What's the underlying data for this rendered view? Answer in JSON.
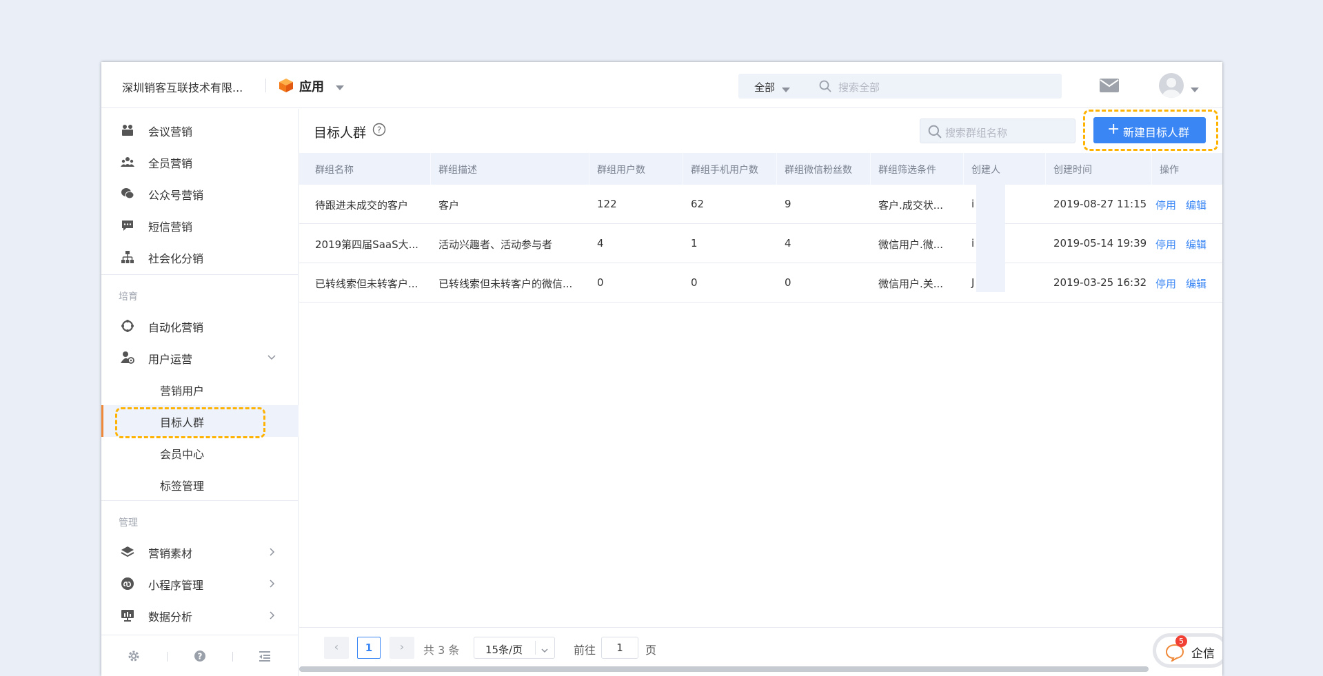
{
  "topbar": {
    "company": "深圳销客互联技术有限...",
    "app_title": "应用",
    "search_scope": "全部",
    "search_placeholder": "搜索全部"
  },
  "sidebar": {
    "items": [
      {
        "label": "会议营销",
        "icon": "meeting-icon"
      },
      {
        "label": "全员营销",
        "icon": "team-icon"
      },
      {
        "label": "公众号营销",
        "icon": "wechat-icon"
      },
      {
        "label": "短信营销",
        "icon": "sms-icon"
      },
      {
        "label": "社会化分销",
        "icon": "org-tree-icon"
      }
    ],
    "section_cultivate": "培育",
    "cultivate_items": [
      {
        "label": "自动化营销",
        "icon": "automation-icon"
      },
      {
        "label": "用户运营",
        "icon": "user-ops-icon"
      }
    ],
    "user_ops_children": [
      "营销用户",
      "目标人群",
      "会员中心",
      "标签管理"
    ],
    "section_manage": "管理",
    "manage_items": [
      {
        "label": "营销素材",
        "icon": "layers-icon"
      },
      {
        "label": "小程序管理",
        "icon": "miniprogram-icon"
      },
      {
        "label": "数据分析",
        "icon": "analytics-icon"
      }
    ]
  },
  "main": {
    "title": "目标人群",
    "group_search_placeholder": "搜索群组名称",
    "new_button": "新建目标人群",
    "columns": [
      "群组名称",
      "群组描述",
      "群组用户数",
      "群组手机用户数",
      "群组微信粉丝数",
      "群组筛选条件",
      "创建人",
      "创建时间",
      "操作"
    ],
    "rows": [
      {
        "name": "待跟进未成交的客户",
        "desc": "客户",
        "users": "122",
        "phone_users": "62",
        "wechat_fans": "9",
        "filter": "客户.成交状...",
        "creator": "i",
        "created": "2019-08-27 11:15",
        "disable": "停用",
        "edit": "编辑"
      },
      {
        "name": "2019第四届SaaS大...",
        "desc": "活动兴趣者、活动参与者",
        "users": "4",
        "phone_users": "1",
        "wechat_fans": "4",
        "filter": "微信用户.微...",
        "creator": "i",
        "created": "2019-05-14 19:39",
        "disable": "停用",
        "edit": "编辑"
      },
      {
        "name": "已转线索但未转客户...",
        "desc": "已转线索但未转客户的微信...",
        "users": "0",
        "phone_users": "0",
        "wechat_fans": "0",
        "filter": "微信用户.关...",
        "creator": "J",
        "created": "2019-03-25 16:32",
        "disable": "停用",
        "edit": "编辑"
      }
    ]
  },
  "pagination": {
    "prev": "‹",
    "next": "›",
    "current_page": "1",
    "total": "共 3 条",
    "page_size": "15条/页",
    "goto_label": "前往",
    "goto_value": "1",
    "page_suffix": "页"
  },
  "chat": {
    "badge": "5",
    "label": "企信"
  },
  "colors": {
    "accent": "#3a86f4",
    "active_bar": "#f0883a",
    "highlight": "#ffb300",
    "header_bg": "#edf2fb"
  }
}
